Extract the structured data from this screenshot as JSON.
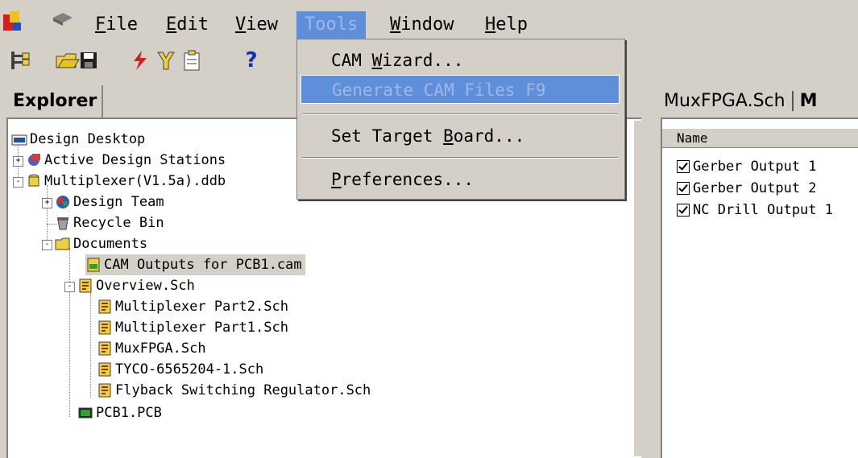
{
  "menubar": {
    "items": [
      {
        "label": "File",
        "mnemonic": "F",
        "rest": "ile"
      },
      {
        "label": "Edit",
        "mnemonic": "E",
        "rest": "dit"
      },
      {
        "label": "View",
        "mnemonic": "V",
        "rest": "iew"
      },
      {
        "label": "Tools",
        "mnemonic": "",
        "rest": "Tools"
      },
      {
        "label": "Window",
        "mnemonic": "W",
        "rest": "indow"
      },
      {
        "label": "Help",
        "mnemonic": "H",
        "rest": "elp"
      }
    ]
  },
  "toolbar": {
    "icons": [
      "tree-toggle-icon",
      "open-folder-icon",
      "save-icon",
      "lightning-icon",
      "wand-icon",
      "clipboard-icon",
      "help-icon"
    ],
    "help_glyph": "?"
  },
  "tools_menu": {
    "items": [
      {
        "pre": "CAM ",
        "mnemonic": "W",
        "post": "izard..."
      },
      {
        "pre": "Generate CAM Files F9",
        "mnemonic": "",
        "post": ""
      },
      {
        "pre": "Set Target ",
        "mnemonic": "B",
        "post": "oard..."
      },
      {
        "pre": "",
        "mnemonic": "P",
        "post": "references..."
      }
    ]
  },
  "explorer": {
    "tab_label": "Explorer",
    "tree": [
      {
        "label": "Design Desktop"
      },
      {
        "label": "Active Design Stations",
        "expander": "+"
      },
      {
        "label": "Multiplexer(V1.5a).ddb",
        "expander": "-"
      },
      {
        "label": "Design Team",
        "expander": "+"
      },
      {
        "label": "Recycle Bin"
      },
      {
        "label": "Documents",
        "expander": "-"
      },
      {
        "label": "CAM Outputs for PCB1.cam"
      },
      {
        "label": "Overview.Sch",
        "expander": "-"
      },
      {
        "label": "Multiplexer Part2.Sch"
      },
      {
        "label": "Multiplexer Part1.Sch"
      },
      {
        "label": "MuxFPGA.Sch"
      },
      {
        "label": "TYCO-6565204-1.Sch"
      },
      {
        "label": "Flyback Switching Regulator.Sch"
      },
      {
        "label": "PCB1.PCB"
      }
    ]
  },
  "right_panel": {
    "tabs": [
      "MuxFPGA.Sch",
      "M"
    ],
    "column_header": "Name",
    "outputs": [
      "Gerber Output 1",
      "Gerber Output 2",
      "NC Drill Output 1"
    ]
  },
  "colors": {
    "highlight": "#5f8fd8",
    "face": "#d4d0c8"
  }
}
